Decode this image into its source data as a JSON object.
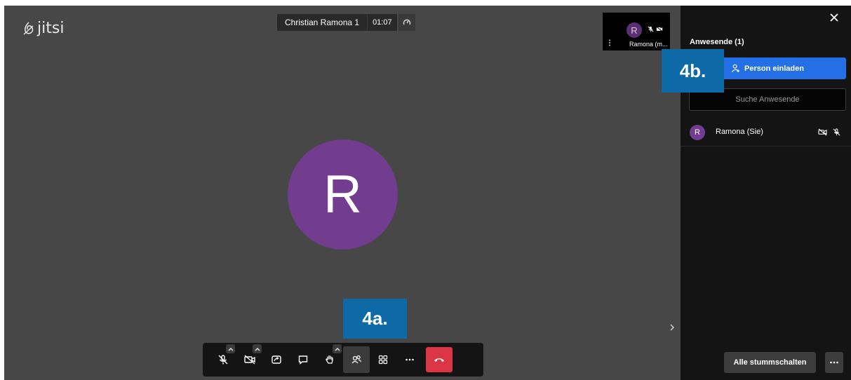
{
  "logo": {
    "text": "jitsi",
    "icon": "jitsi-logo-icon"
  },
  "header": {
    "meeting_title": "Christian Ramona 1",
    "timer": "01:07",
    "stats_icon": "connection-stats-icon"
  },
  "thumbnail": {
    "avatar_letter": "R",
    "name": "Ramona (m...",
    "icons": [
      "mic-muted-icon",
      "video-off-icon"
    ]
  },
  "main": {
    "avatar_letter": "R",
    "avatar_color": "#723c8f"
  },
  "annotations": {
    "a": "4a.",
    "b": "4b.",
    "color": "#0d6aa6"
  },
  "toolbar": {
    "buttons": [
      {
        "name": "microphone",
        "icon": "mic-muted-icon"
      },
      {
        "name": "camera",
        "icon": "video-off-icon"
      },
      {
        "name": "share-screen",
        "icon": "screen-share-icon"
      },
      {
        "name": "chat",
        "icon": "chat-icon"
      },
      {
        "name": "raise-hand",
        "icon": "hand-icon"
      },
      {
        "name": "participants",
        "icon": "participants-icon"
      },
      {
        "name": "tile-view",
        "icon": "tile-view-icon"
      },
      {
        "name": "more",
        "icon": "more-icon"
      },
      {
        "name": "hangup",
        "icon": "hangup-icon"
      }
    ],
    "hangup_color": "#dc3545"
  },
  "panel": {
    "title": "Anwesende (1)",
    "invite_label": "Person einladen",
    "search_placeholder": "Suche Anwesende",
    "participants": [
      {
        "letter": "R",
        "name": "Ramona (Sie)"
      }
    ],
    "mute_all_label": "Alle stummschalten",
    "accent": "#246fe5"
  }
}
